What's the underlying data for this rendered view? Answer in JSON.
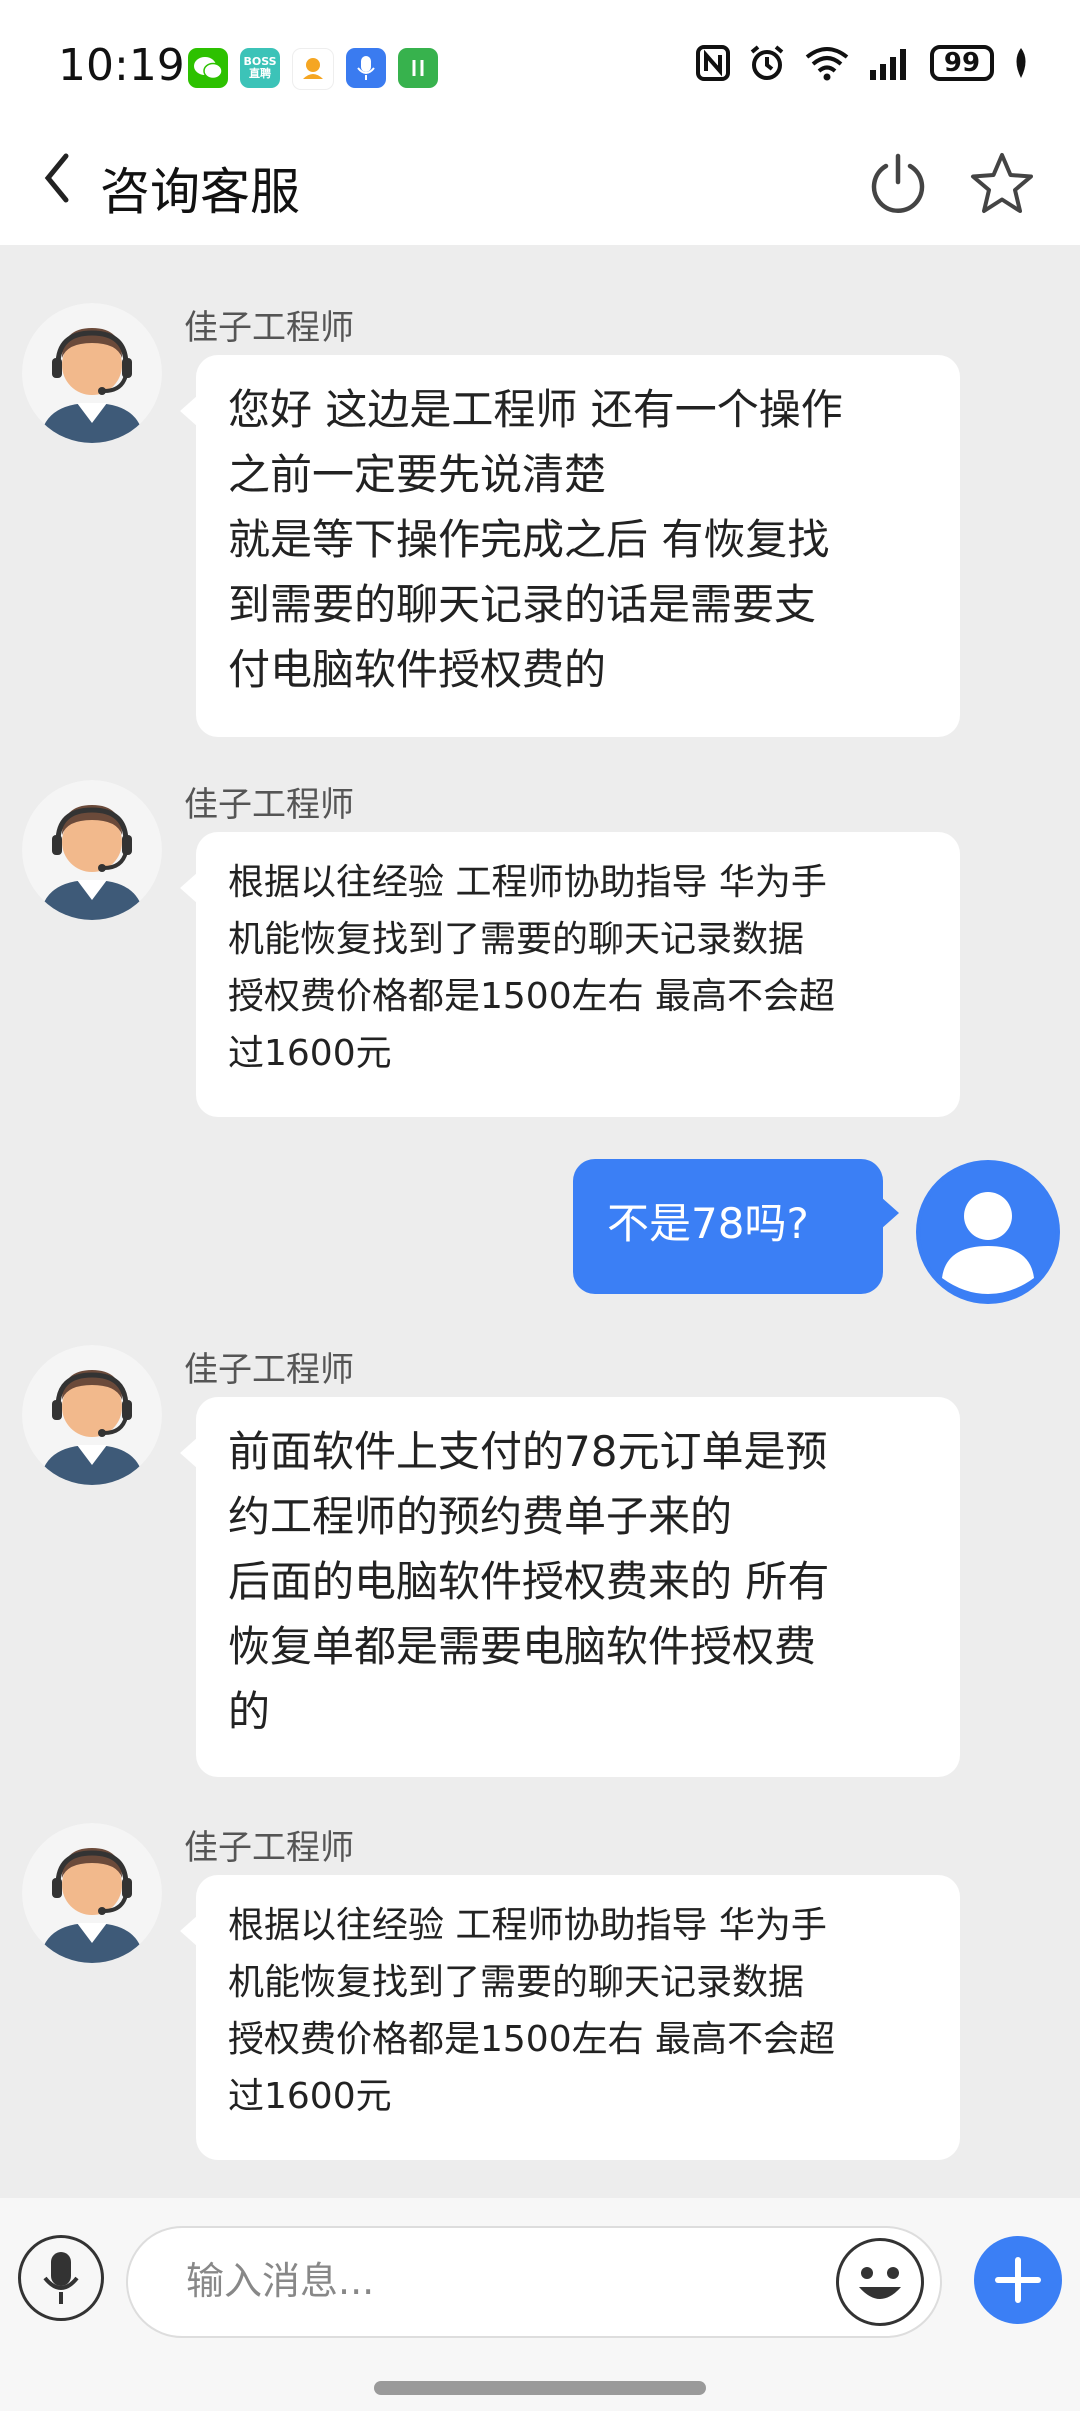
{
  "status_bar": {
    "time": "10:19",
    "battery": "99",
    "app_icons": [
      "wechat-icon",
      "boss-zhipin-icon",
      "app-icon",
      "voice-recorder-icon",
      "app-icon-green"
    ],
    "boss_label": "BOSS\n直聘"
  },
  "header": {
    "title": "咨询客服"
  },
  "messages": [
    {
      "sender": "佳子工程师",
      "text": "您好 这边是工程师 还有一个操作\n之前一定要先说清楚\n就是等下操作完成之后 有恢复找\n到需要的聊天记录的话是需要支\n付电脑软件授权费的"
    },
    {
      "sender": "佳子工程师",
      "text": "根据以往经验 工程师协助指导 华为手\n机能恢复找到了需要的聊天记录数据\n授权费价格都是1500左右 最高不会超\n过1600元"
    },
    {
      "sender": "me",
      "text": "不是78吗?"
    },
    {
      "sender": "佳子工程师",
      "text": "前面软件上支付的78元订单是预\n约工程师的预约费单子来的\n后面的电脑软件授权费来的 所有\n恢复单都是需要电脑软件授权费\n的"
    },
    {
      "sender": "佳子工程师",
      "text": "根据以往经验 工程师协助指导 华为手\n机能恢复找到了需要的聊天记录数据\n授权费价格都是1500左右 最高不会超\n过1600元"
    }
  ],
  "input": {
    "placeholder": "输入消息..."
  },
  "colors": {
    "accent": "#3b7ff5",
    "background": "#ededed"
  }
}
